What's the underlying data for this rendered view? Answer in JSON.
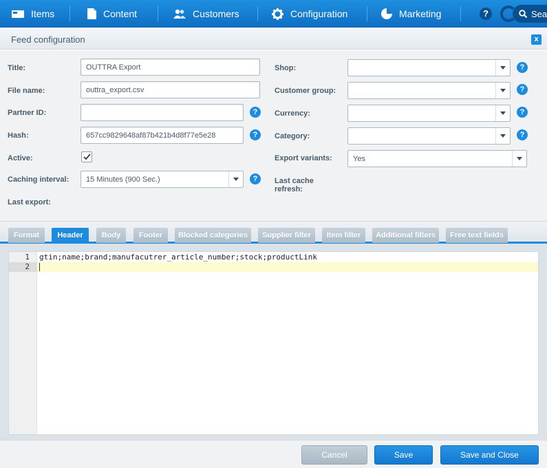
{
  "nav": {
    "items": [
      {
        "label": "Items",
        "icon": "items-icon"
      },
      {
        "label": "Content",
        "icon": "content-icon"
      },
      {
        "label": "Customers",
        "icon": "customers-icon"
      },
      {
        "label": "Configuration",
        "icon": "gear-icon"
      },
      {
        "label": "Marketing",
        "icon": "pie-chart-icon"
      }
    ],
    "help": "?",
    "search_label": "Sea"
  },
  "window": {
    "title": "Feed configuration",
    "close": "x"
  },
  "form": {
    "title_label": "Title:",
    "title_value": "OUTTRA Export",
    "filename_label": "File name:",
    "filename_value": "outtra_export.csv",
    "partner_label": "Partner ID:",
    "partner_value": "",
    "hash_label": "Hash:",
    "hash_value": "657cc9829648af87b421b4d8f77e5e28",
    "active_label": "Active:",
    "active_checked": true,
    "caching_label": "Caching interval:",
    "caching_value": "15 Minutes (900 Sec.)",
    "last_export_label": "Last export:",
    "shop_label": "Shop:",
    "shop_value": "",
    "customer_group_label": "Customer group:",
    "customer_group_value": "",
    "currency_label": "Currency:",
    "currency_value": "",
    "category_label": "Category:",
    "category_value": "",
    "export_variants_label": "Export variants:",
    "export_variants_value": "Yes",
    "last_cache_label_1": "Last cache",
    "last_cache_label_2": "refresh:",
    "help_glyph": "?"
  },
  "tabs": [
    {
      "label": "Format",
      "active": false
    },
    {
      "label": "Header",
      "active": true
    },
    {
      "label": "Body",
      "active": false
    },
    {
      "label": "Footer",
      "active": false
    },
    {
      "label": "Blocked categories",
      "active": false
    },
    {
      "label": "Supplier filter",
      "active": false
    },
    {
      "label": "Item filter",
      "active": false
    },
    {
      "label": "Additional filters",
      "active": false
    },
    {
      "label": "Free text fields",
      "active": false
    }
  ],
  "editor": {
    "lines": [
      {
        "number": "1",
        "text": "gtin;name;brand;manufacutrer_article_number;stock;productLink"
      },
      {
        "number": "2",
        "text": ""
      }
    ]
  },
  "footer": {
    "cancel": "Cancel",
    "save": "Save",
    "save_close": "Save and Close"
  },
  "colors": {
    "accent": "#1d8be0",
    "nav": "#1479cf",
    "secondary_button": "#aebdc8"
  }
}
